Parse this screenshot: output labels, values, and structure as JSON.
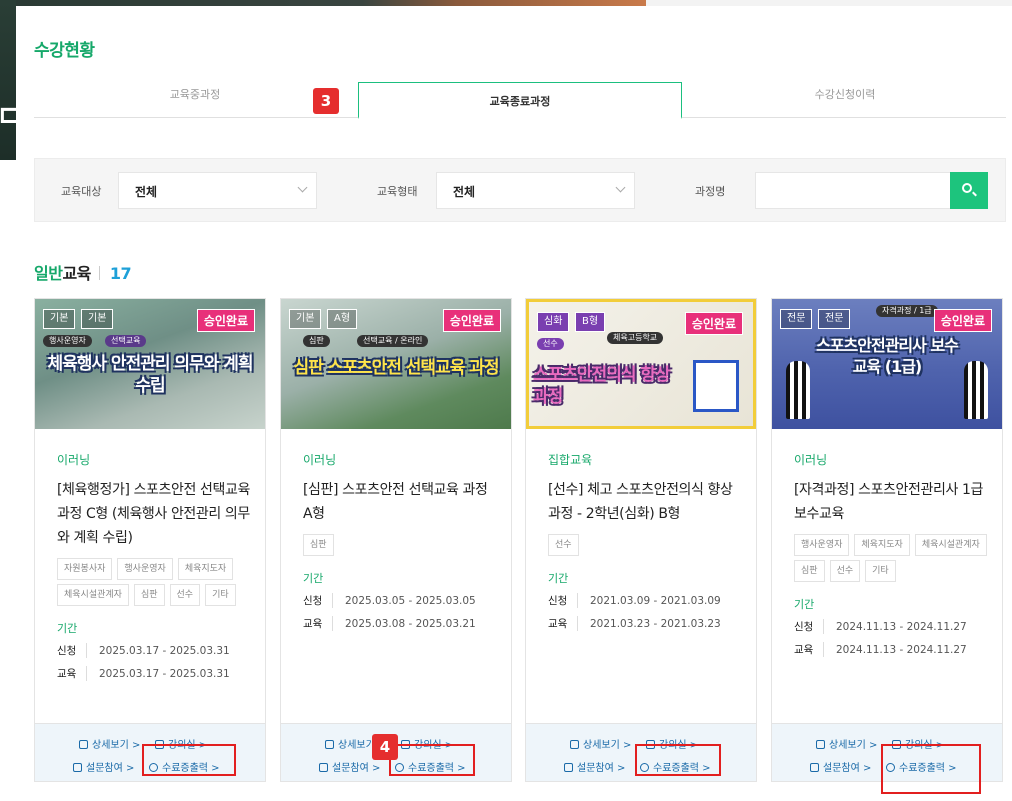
{
  "page_title": "수강현황",
  "tabs": [
    {
      "label": "교육중과정",
      "active": false
    },
    {
      "label": "교육종료과정",
      "active": true
    },
    {
      "label": "수강신청이력",
      "active": false
    }
  ],
  "badges": {
    "tab_step": "3",
    "cert_step": "4"
  },
  "filters": {
    "target_label": "교육대상",
    "target_value": "전체",
    "type_label": "교육형태",
    "type_value": "전체",
    "course_label": "과정명",
    "course_value": ""
  },
  "section": {
    "title_green": "일반",
    "title_dark": "교육",
    "count": "17"
  },
  "cards": [
    {
      "thumb_tags": [
        "기본",
        "기본"
      ],
      "thumb_pills": [
        "행사운영자",
        "선택교육"
      ],
      "thumb_approved": "승인완료",
      "thumb_headline": "체육행사 안전관리 의무와 계획 수립",
      "type": "이러닝",
      "title": "[체육행정가] 스포츠안전 선택교육 과정 C형 (체육행사 안전관리 의무와 계획 수립)",
      "chips": [
        "자원봉사자",
        "행사운영자",
        "체육지도자",
        "체육시설관계자",
        "심판",
        "선수",
        "기타"
      ],
      "period_label": "기간",
      "apply_key": "신청",
      "apply_range": "2025.03.17 - 2025.03.31",
      "edu_key": "교육",
      "edu_range": "2025.03.17 - 2025.03.31",
      "link_detail": "상세보기 >",
      "link_class": "강의실 >",
      "link_survey": "설문참여 >",
      "link_cert": "수료증출력 >"
    },
    {
      "thumb_tags": [
        "기본",
        "A형"
      ],
      "thumb_pills": [
        "심판",
        "선택교육 / 온라인"
      ],
      "thumb_approved": "승인완료",
      "thumb_headline": "심판 스포츠안전 선택교육 과정",
      "type": "이러닝",
      "title": "[심판] 스포츠안전 선택교육 과정 A형",
      "chips": [
        "심판"
      ],
      "period_label": "기간",
      "apply_key": "신청",
      "apply_range": "2025.03.05 - 2025.03.05",
      "edu_key": "교육",
      "edu_range": "2025.03.08 - 2025.03.21",
      "link_detail": "상세보기 >",
      "link_class": "강의실 >",
      "link_survey": "설문참여 >",
      "link_cert": "수료증출력 >"
    },
    {
      "thumb_tags": [
        "심화",
        "B형"
      ],
      "thumb_pills": [
        "선수",
        "체육고등학교"
      ],
      "thumb_approved": "승인완료",
      "thumb_headline": "스포츠안전의식 향상과정",
      "type": "집합교육",
      "title": "[선수] 체고 스포츠안전의식 향상과정 - 2학년(심화) B형",
      "chips": [
        "선수"
      ],
      "period_label": "기간",
      "apply_key": "신청",
      "apply_range": "2021.03.09 - 2021.03.09",
      "edu_key": "교육",
      "edu_range": "2021.03.23 - 2021.03.23",
      "link_detail": "상세보기 >",
      "link_class": "강의실 >",
      "link_survey": "설문참여 >",
      "link_cert": "수료증출력 >"
    },
    {
      "thumb_tags": [
        "전문",
        "전문"
      ],
      "thumb_pills": [
        "자격과정 / 1급"
      ],
      "thumb_approved": "승인완료",
      "thumb_headline": "스포츠안전관리사 보수교육 (1급)",
      "type": "이러닝",
      "title": "[자격과정] 스포츠안전관리사 1급 보수교육",
      "chips": [
        "행사운영자",
        "체육지도자",
        "체육시설관계자",
        "심판",
        "선수",
        "기타"
      ],
      "period_label": "기간",
      "apply_key": "신청",
      "apply_range": "2024.11.13 - 2024.11.27",
      "edu_key": "교육",
      "edu_range": "2024.11.13 - 2024.11.27",
      "link_detail": "상세보기 >",
      "link_class": "강의실 >",
      "link_survey": "설문참여 >",
      "link_cert": "수료증출력 >"
    }
  ],
  "colors": {
    "accent_green": "#16a86a",
    "approved_pink": "#e8307a",
    "badge_red": "#e52e2e",
    "link_blue": "#1a6aa8"
  }
}
